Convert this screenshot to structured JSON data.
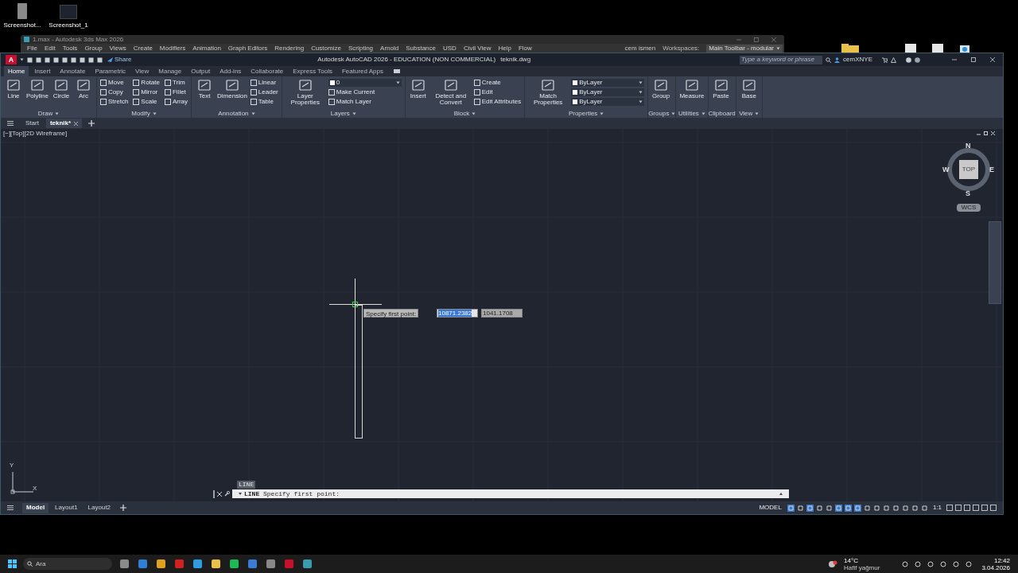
{
  "desktop_icons": [
    {
      "label": "Screenshot..."
    },
    {
      "label": "Screenshot_1"
    }
  ],
  "background_window": {
    "title": "1.max - Autodesk 3ds Max 2026",
    "menu": [
      "File",
      "Edit",
      "Tools",
      "Group",
      "Views",
      "Create",
      "Modifiers",
      "Animation",
      "Graph Editors",
      "Rendering",
      "Customize",
      "Scripting",
      "Arnold",
      "Substance",
      "USD",
      "Civil View",
      "Help",
      "Flow"
    ],
    "user": "cem ismen",
    "workspaces_label": "Workspaces:",
    "workspace": "Main Toolbar - modular"
  },
  "app": {
    "logo": "A",
    "share": "Share",
    "title": "Autodesk AutoCAD 2026 - EDUCATION (NON COMMERCIAL)",
    "filename": "teknik.dwg",
    "search": {
      "placeholder": "Type a keyword or phrase"
    },
    "user": "cemXNYE"
  },
  "ribbon_tabs": [
    {
      "label": "Home",
      "selected": true
    },
    {
      "label": "Insert",
      "selected": false
    },
    {
      "label": "Annotate",
      "selected": false
    },
    {
      "label": "Parametric",
      "selected": false
    },
    {
      "label": "View",
      "selected": false
    },
    {
      "label": "Manage",
      "selected": false
    },
    {
      "label": "Output",
      "selected": false
    },
    {
      "label": "Add-ins",
      "selected": false
    },
    {
      "label": "Collaborate",
      "selected": false
    },
    {
      "label": "Express Tools",
      "selected": false
    },
    {
      "label": "Featured Apps",
      "selected": false
    }
  ],
  "ribbon_panels": [
    {
      "title": "Draw",
      "expandable": true,
      "items": [
        {
          "kind": "large",
          "label": "Line"
        },
        {
          "kind": "large",
          "label": "Polyline"
        },
        {
          "kind": "large",
          "label": "Circle"
        },
        {
          "kind": "large",
          "label": "Arc"
        }
      ]
    },
    {
      "title": "Modify",
      "expandable": true,
      "items": [
        {
          "kind": "small",
          "label": "Move"
        },
        {
          "kind": "small",
          "label": "Copy"
        },
        {
          "kind": "small",
          "label": "Stretch"
        },
        {
          "kind": "small",
          "label": "Rotate"
        },
        {
          "kind": "small",
          "label": "Mirror"
        },
        {
          "kind": "small",
          "label": "Scale"
        },
        {
          "kind": "small",
          "label": "Trim"
        },
        {
          "kind": "small",
          "label": "Fillet"
        },
        {
          "kind": "small",
          "label": "Array"
        }
      ]
    },
    {
      "title": "Annotation",
      "expandable": true,
      "items": [
        {
          "kind": "large",
          "label": "Text"
        },
        {
          "kind": "large",
          "label": "Dimension"
        },
        {
          "kind": "small",
          "label": "Linear"
        },
        {
          "kind": "small",
          "label": "Leader"
        },
        {
          "kind": "small",
          "label": "Table"
        }
      ]
    },
    {
      "title": "Layers",
      "expandable": true,
      "items": [
        {
          "kind": "large",
          "label": "Layer Properties"
        },
        {
          "kind": "dropdown",
          "label": "0"
        },
        {
          "kind": "small",
          "label": "Make Current"
        },
        {
          "kind": "small",
          "label": "Match Layer"
        }
      ]
    },
    {
      "title": "Block",
      "expandable": true,
      "items": [
        {
          "kind": "large",
          "label": "Insert"
        },
        {
          "kind": "large",
          "label": "Detect and Convert"
        },
        {
          "kind": "small",
          "label": "Create"
        },
        {
          "kind": "small",
          "label": "Edit"
        },
        {
          "kind": "small",
          "label": "Edit Attributes"
        }
      ]
    },
    {
      "title": "Properties",
      "expandable": true,
      "items": [
        {
          "kind": "large",
          "label": "Match Properties"
        },
        {
          "kind": "dropdown",
          "label": "ByLayer"
        },
        {
          "kind": "dropdown",
          "label": "ByLayer"
        },
        {
          "kind": "dropdown",
          "label": "ByLayer"
        }
      ]
    },
    {
      "title": "Groups",
      "expandable": true,
      "items": [
        {
          "kind": "large",
          "label": "Group"
        }
      ]
    },
    {
      "title": "Utilities",
      "expandable": true,
      "items": [
        {
          "kind": "large",
          "label": "Measure"
        }
      ]
    },
    {
      "title": "Clipboard",
      "expandable": false,
      "items": [
        {
          "kind": "large",
          "label": "Paste"
        }
      ]
    },
    {
      "title": "View",
      "expandable": true,
      "items": [
        {
          "kind": "large",
          "label": "Base"
        }
      ]
    }
  ],
  "file_tabs": [
    {
      "label": "Start",
      "selected": false,
      "closable": false
    },
    {
      "label": "teknik*",
      "selected": true,
      "closable": true
    }
  ],
  "viewport": {
    "label": "[−][Top][2D Wireframe]",
    "viewcube": {
      "face": "TOP",
      "north": "N",
      "south": "S",
      "east": "E",
      "west": "W",
      "ucs": "WCS"
    },
    "ucs_axes": {
      "x": "X",
      "y": "Y"
    },
    "cursor_prompt": "Specify first point:",
    "coordinate_inputs": [
      {
        "value": "10871.2382",
        "selected": true
      },
      {
        "value": "1041.1708",
        "selected": false
      }
    ]
  },
  "command_line": {
    "recent": "LINE",
    "text": "**LINE** Specify first point:"
  },
  "layout_tabs": [
    {
      "label": "Model",
      "selected": true
    },
    {
      "label": "Layout1",
      "selected": false
    },
    {
      "label": "Layout2",
      "selected": false
    }
  ],
  "status_bar": {
    "space": "MODEL",
    "scale": "1:1",
    "toggles": [
      {
        "on": true
      },
      {
        "on": false
      },
      {
        "on": true
      },
      {
        "on": false
      },
      {
        "on": false
      },
      {
        "on": true
      },
      {
        "on": true
      },
      {
        "on": true
      },
      {
        "on": false
      },
      {
        "on": false
      },
      {
        "on": false
      },
      {
        "on": false
      },
      {
        "on": false
      },
      {
        "on": false
      },
      {
        "on": false
      }
    ]
  },
  "taskbar": {
    "search": {
      "placeholder": "Ara"
    },
    "weather": {
      "temperature": "14°C",
      "condition": "Hafif yağmur"
    },
    "time": "12:42",
    "date": "3.04.2026"
  }
}
